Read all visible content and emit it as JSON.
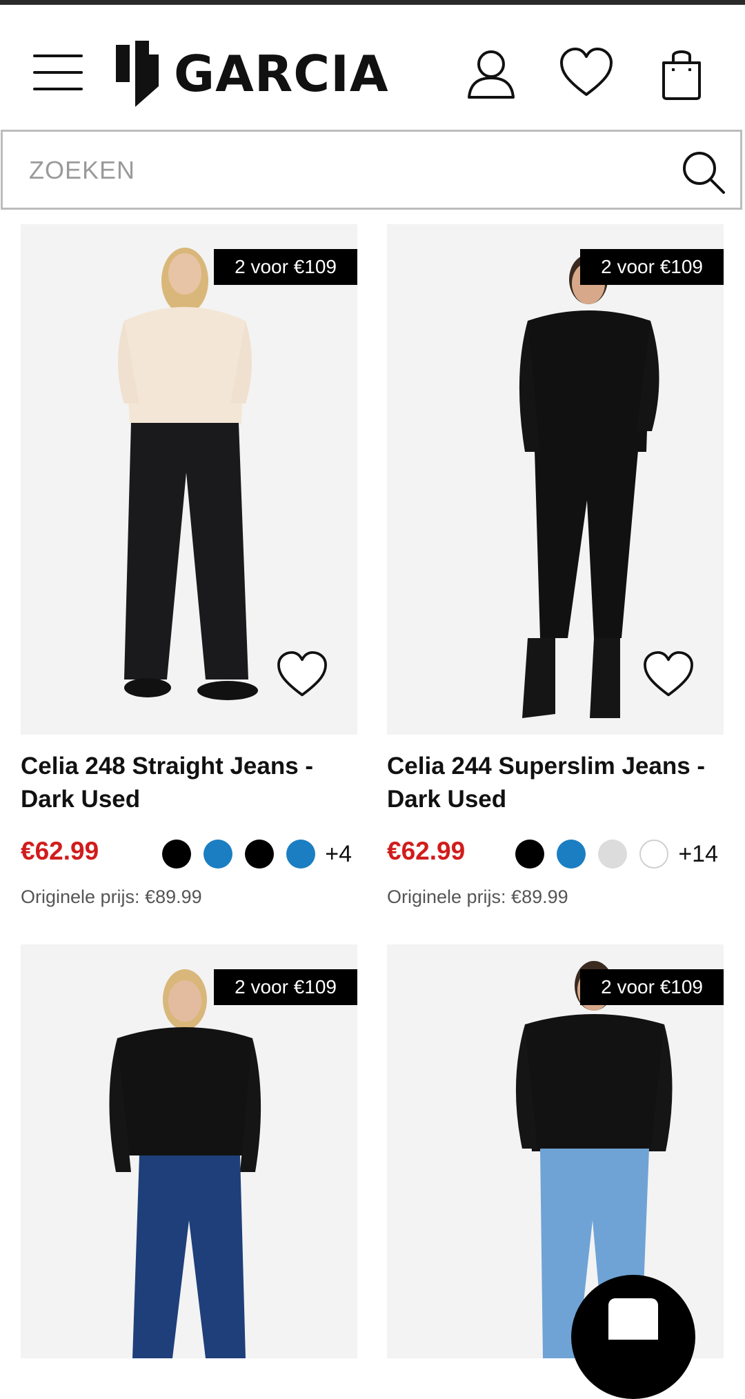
{
  "header": {
    "brand": "GARCIA",
    "menu_icon": "hamburger-menu-icon",
    "account_icon": "user-icon",
    "wishlist_icon": "heart-icon",
    "bag_icon": "shopping-bag-icon"
  },
  "search": {
    "placeholder": "ZOEKEN",
    "icon": "search-icon"
  },
  "colors": {
    "price": "#d11c1c",
    "badge_bg": "#000000",
    "badge_text": "#ffffff"
  },
  "products": [
    {
      "badge": "2 voor €109",
      "title": "Celia 248 Straight Jeans - Dark Used",
      "price": "€62.99",
      "original_price": "Originele prijs: €89.99",
      "swatches": [
        "#000000",
        "#1b7ec2",
        "#000000",
        "#1b7ec2"
      ],
      "more_colors": "+4"
    },
    {
      "badge": "2 voor €109",
      "title": "Celia 244 Superslim Jeans - Dark Used",
      "price": "€62.99",
      "original_price": "Originele prijs: €89.99",
      "swatches": [
        "#000000",
        "#1b7ec2",
        "#dcdcdc",
        "#ffffff"
      ],
      "more_colors": "+14"
    },
    {
      "badge": "2 voor €109"
    },
    {
      "badge": "2 voor €109"
    }
  ],
  "chat_button": {
    "icon": "chat-icon"
  }
}
